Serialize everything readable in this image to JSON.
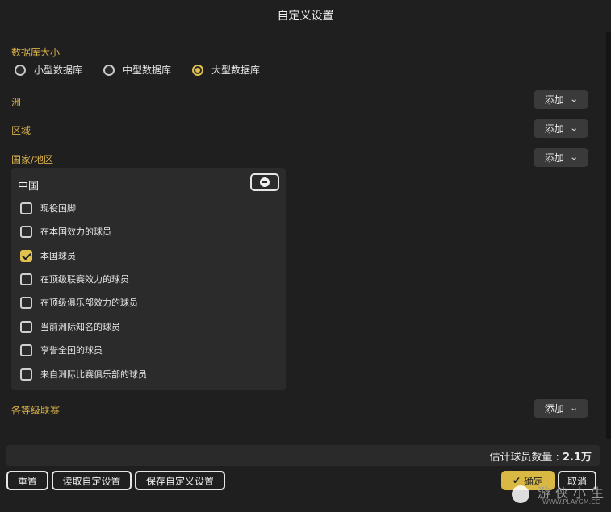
{
  "window": {
    "title": "自定义设置"
  },
  "database_size": {
    "label": "数据库大小",
    "options": [
      {
        "label": "小型数据库",
        "selected": false
      },
      {
        "label": "中型数据库",
        "selected": false
      },
      {
        "label": "大型数据库",
        "selected": true
      }
    ]
  },
  "sections": {
    "continent": {
      "label": "洲",
      "add_label": "添加"
    },
    "region": {
      "label": "区域",
      "add_label": "添加"
    },
    "country": {
      "label": "国家/地区",
      "add_label": "添加"
    },
    "leagues": {
      "label": "各等级联赛",
      "add_label": "添加"
    }
  },
  "country_panel": {
    "name": "中国",
    "options": [
      {
        "label": "现役国脚",
        "checked": false
      },
      {
        "label": "在本国效力的球员",
        "checked": false
      },
      {
        "label": "本国球员",
        "checked": true
      },
      {
        "label": "在顶级联赛效力的球员",
        "checked": false
      },
      {
        "label": "在顶级俱乐部效力的球员",
        "checked": false
      },
      {
        "label": "当前洲际知名的球员",
        "checked": false
      },
      {
        "label": "享誉全国的球员",
        "checked": false
      },
      {
        "label": "来自洲际比赛俱乐部的球员",
        "checked": false
      }
    ]
  },
  "estimate": {
    "label": "估计球员数量 : ",
    "value": "2.1万"
  },
  "buttons": {
    "reset": "重置",
    "load": "读取自定设置",
    "save": "保存自定义设置",
    "confirm": "确定",
    "cancel": "取消"
  },
  "watermark": {
    "text": "游侠小生",
    "url": "WWW.PLAYGM.CC"
  },
  "colors": {
    "accent": "#d9b844",
    "background": "#1f1f1f",
    "panel": "#2b2b2b"
  }
}
